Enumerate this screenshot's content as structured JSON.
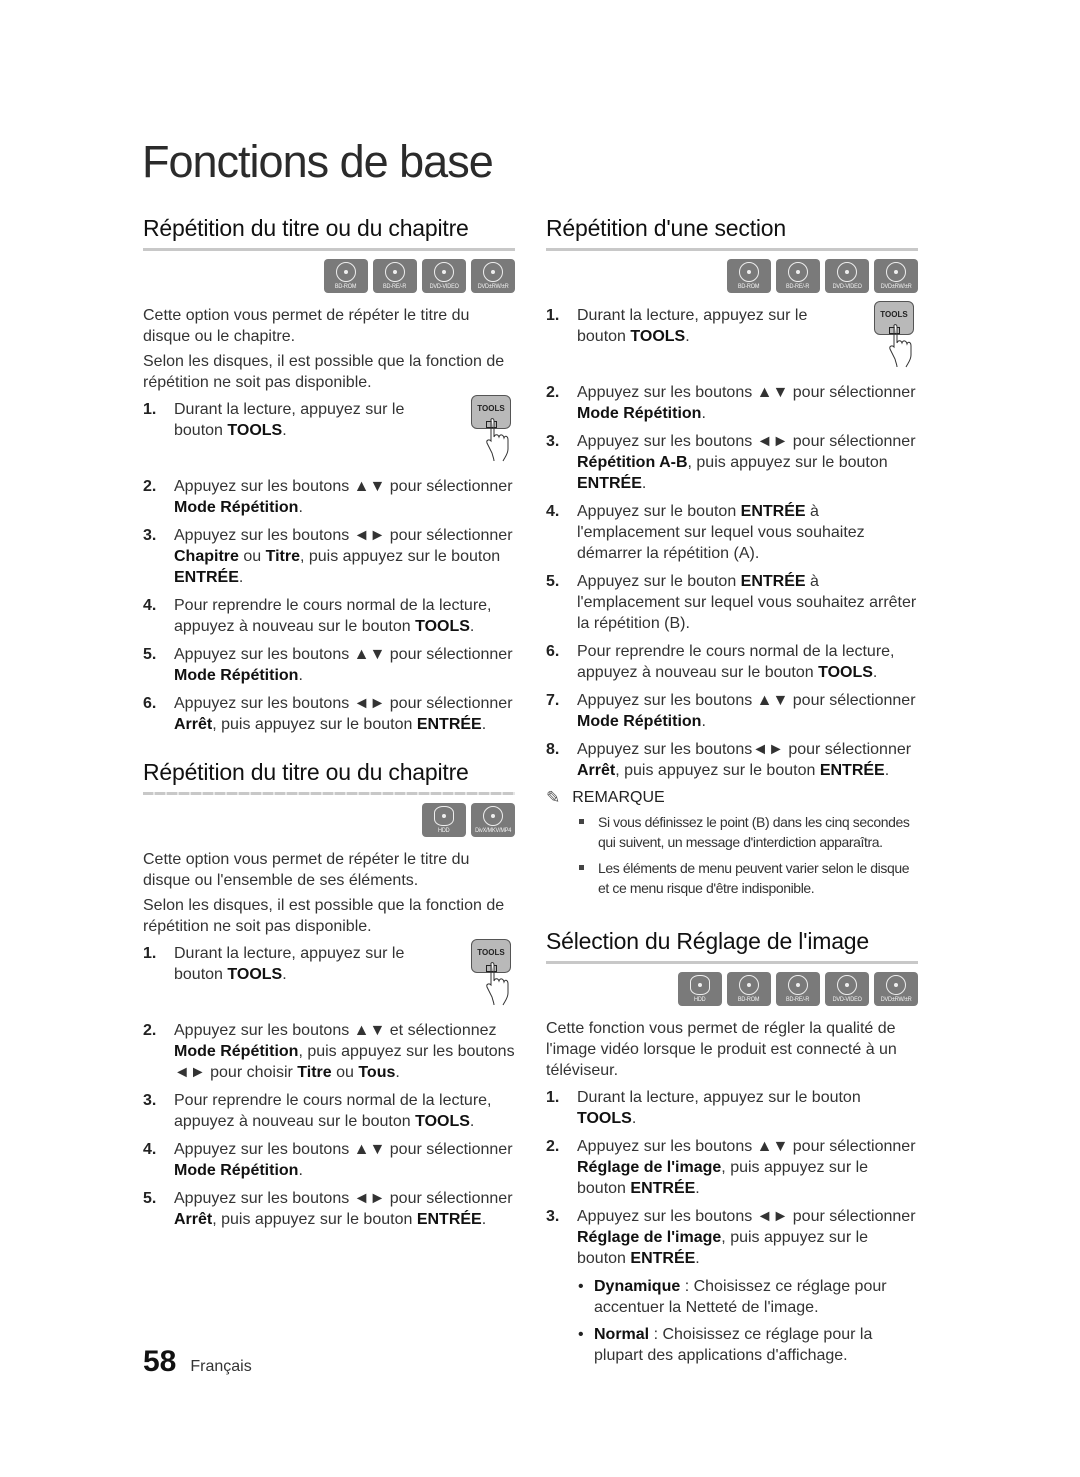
{
  "page_title": "Fonctions de base",
  "left": {
    "section1": {
      "title": "Répétition du titre ou du chapitre",
      "icons": [
        "BD-ROM",
        "BD-RE/-R",
        "DVD-VIDEO",
        "DVD±RW/±R"
      ],
      "paragraphs": [
        "Cette option vous permet de répéter le titre du disque ou le chapitre.",
        "Selon les disques, il est possible que la fonction de répétition ne soit pas disponible."
      ],
      "steps": [
        {
          "num": "1.",
          "parts": [
            "Durant la lecture, appuyez sur le bouton ",
            "TOOLS",
            "."
          ]
        },
        {
          "num": "2.",
          "parts": [
            "Appuyez sur les boutons ▲▼ pour sélectionner ",
            "Mode Répétition",
            "."
          ]
        },
        {
          "num": "3.",
          "parts": [
            "Appuyez sur les boutons ◄► pour sélectionner ",
            "Chapitre",
            " ou ",
            "Titre",
            ", puis appuyez sur le bouton ",
            "ENTRÉE",
            "."
          ]
        },
        {
          "num": "4.",
          "parts": [
            "Pour reprendre le cours normal de la lecture, appuyez à nouveau sur le bouton ",
            "TOOLS",
            "."
          ]
        },
        {
          "num": "5.",
          "parts": [
            "Appuyez sur les boutons ▲▼ pour sélectionner ",
            "Mode Répétition",
            "."
          ]
        },
        {
          "num": "6.",
          "parts": [
            "Appuyez sur les boutons ◄► pour sélectionner ",
            "Arrêt",
            ", puis appuyez sur le bouton ",
            "ENTRÉE",
            "."
          ]
        }
      ]
    },
    "section2": {
      "title": "Répétition du titre ou du chapitre",
      "icons": [
        "HDD",
        "DivX/MKV/MP4"
      ],
      "paragraphs": [
        "Cette option vous permet de répéter le titre du disque ou l'ensemble de ses éléments.",
        "Selon les disques, il est possible que la fonction de répétition ne soit pas disponible."
      ],
      "steps": [
        {
          "num": "1.",
          "parts": [
            "Durant la lecture, appuyez sur le bouton ",
            "TOOLS",
            "."
          ]
        },
        {
          "num": "2.",
          "parts": [
            "Appuyez sur les boutons ▲▼ et sélectionnez ",
            "Mode Répétition",
            ", puis appuyez sur les boutons ◄► pour choisir ",
            "Titre",
            " ou ",
            "Tous",
            "."
          ]
        },
        {
          "num": "3.",
          "parts": [
            "Pour reprendre le cours normal de la lecture, appuyez à nouveau sur le bouton ",
            "TOOLS",
            "."
          ]
        },
        {
          "num": "4.",
          "parts": [
            "Appuyez sur les boutons ▲▼ pour sélectionner ",
            "Mode Répétition",
            "."
          ]
        },
        {
          "num": "5.",
          "parts": [
            "Appuyez sur les boutons ◄► pour sélectionner ",
            "Arrêt",
            ", puis appuyez sur le bouton ",
            "ENTRÉE",
            "."
          ]
        }
      ]
    }
  },
  "right": {
    "section1": {
      "title": "Répétition d'une section",
      "icons": [
        "BD-ROM",
        "BD-RE/-R",
        "DVD-VIDEO",
        "DVD±RW/±R"
      ],
      "steps": [
        {
          "num": "1.",
          "parts": [
            "Durant la lecture, appuyez sur le bouton ",
            "TOOLS",
            "."
          ]
        },
        {
          "num": "2.",
          "parts": [
            "Appuyez sur les boutons ▲▼ pour sélectionner ",
            "Mode Répétition",
            "."
          ]
        },
        {
          "num": "3.",
          "parts": [
            "Appuyez sur les boutons ◄► pour sélectionner ",
            "Répétition A-B",
            ", puis appuyez sur le bouton ",
            "ENTRÉE",
            "."
          ]
        },
        {
          "num": "4.",
          "parts": [
            "Appuyez sur le bouton ",
            "ENTRÉE",
            " à l'emplacement sur lequel vous souhaitez démarrer la répétition (A)."
          ]
        },
        {
          "num": "5.",
          "parts": [
            "Appuyez sur le bouton ",
            "ENTRÉE",
            " à l'emplacement sur lequel vous souhaitez arrêter la répétition (B)."
          ]
        },
        {
          "num": "6.",
          "parts": [
            "Pour reprendre le cours normal de la lecture, appuyez à nouveau sur le bouton ",
            "TOOLS",
            "."
          ]
        },
        {
          "num": "7.",
          "parts": [
            "Appuyez sur les boutons ▲▼ pour sélectionner ",
            "Mode Répétition",
            "."
          ]
        },
        {
          "num": "8.",
          "parts": [
            "Appuyez sur les boutons◄► pour sélectionner ",
            "Arrêt",
            ", puis appuyez sur le bouton ",
            "ENTRÉE",
            "."
          ]
        }
      ],
      "note_title": "REMARQUE",
      "notes": [
        "Si vous définissez le point (B) dans les cinq secondes qui suivent, un message d'interdiction apparaîtra.",
        "Les éléments de menu peuvent varier selon le disque et ce menu risque d'être indisponible."
      ]
    },
    "section2": {
      "title": "Sélection du Réglage de l'image",
      "icons": [
        "HDD",
        "BD-ROM",
        "BD-RE/-R",
        "DVD-VIDEO",
        "DVD±RW/±R"
      ],
      "paragraphs": [
        "Cette fonction vous permet de régler la qualité de l'image vidéo lorsque le produit est connecté à un téléviseur."
      ],
      "steps": [
        {
          "num": "1.",
          "parts": [
            "Durant la lecture, appuyez sur le bouton ",
            "TOOLS",
            "."
          ]
        },
        {
          "num": "2.",
          "parts": [
            "Appuyez sur les boutons ▲▼ pour sélectionner ",
            "Réglage de l'image",
            ", puis appuyez sur le bouton ",
            "ENTRÉE",
            "."
          ]
        },
        {
          "num": "3.",
          "parts": [
            "Appuyez sur les boutons ◄► pour sélectionner ",
            "Réglage de l'image",
            ", puis appuyez sur le bouton ",
            "ENTRÉE",
            "."
          ]
        }
      ],
      "bullets": [
        {
          "term": "Dynamique",
          "text": " : Choisissez ce réglage pour accentuer la Netteté de l'image."
        },
        {
          "term": "Normal",
          "text": " : Choisissez ce réglage pour la plupart des applications d'affichage."
        }
      ]
    }
  },
  "tools_button_label": "TOOLS",
  "footer": {
    "page_number": "58",
    "language": "Français"
  }
}
